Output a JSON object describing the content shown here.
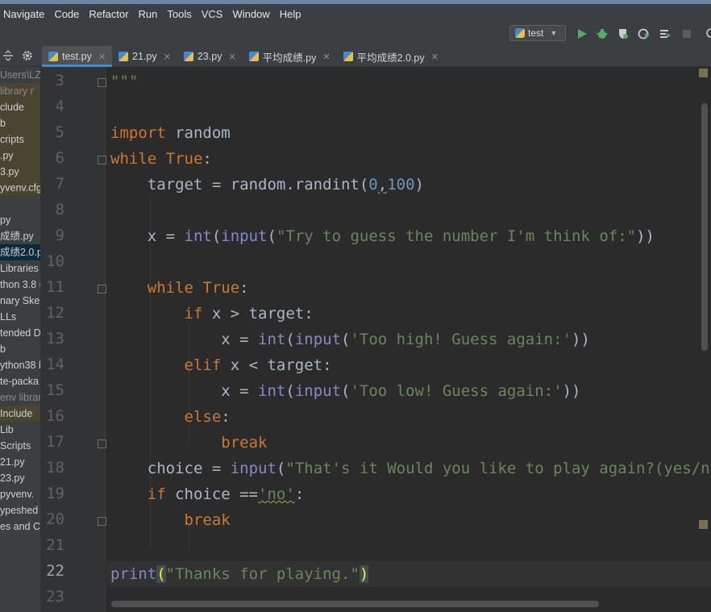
{
  "menu": [
    "Navigate",
    "Code",
    "Refactor",
    "Run",
    "Tools",
    "VCS",
    "Window",
    "Help"
  ],
  "run_config": {
    "label": "test"
  },
  "tabs": [
    {
      "label": "test.py",
      "active": true
    },
    {
      "label": "21.py",
      "active": false
    },
    {
      "label": "23.py",
      "active": false
    },
    {
      "label": "平均成绩.py",
      "active": false
    },
    {
      "label": "平均成绩2.0.py",
      "active": false
    }
  ],
  "sidebar": [
    "Users\\LZ",
    " library r",
    "clude",
    "b",
    "cripts",
    ".py",
    "3.py",
    "yvenv.cfg",
    "",
    "py",
    "成绩.py",
    "成绩2.0.py",
    " Libraries",
    "thon 3.8 (",
    "nary Ske",
    "LLs",
    "tended D",
    "b",
    "ython38  l",
    "te-packa",
    "env  librar",
    " Include",
    " Lib",
    " Scripts",
    "21.py",
    "23.py",
    " pyvenv.",
    "ypeshed",
    "es and Co"
  ],
  "line_numbers": [
    "3",
    "4",
    "5",
    "6",
    "7",
    "8",
    "9",
    "10",
    "11",
    "12",
    "13",
    "14",
    "15",
    "16",
    "17",
    "18",
    "19",
    "20",
    "21",
    "22",
    "23"
  ],
  "current_line": "22",
  "code": {
    "l3": "\"\"\"",
    "l5_kw": "import",
    "l5_rest": " random",
    "l6_kw": "while",
    "l6_true": " True",
    "l6_rest": ":",
    "l7_a": "    target = random.randint(",
    "l7_n1": "0",
    "l7_c": ",",
    "l7_n2": "100",
    "l7_z": ")",
    "l9_a": "    x = ",
    "l9_int": "int",
    "l9_p": "(",
    "l9_input": "input",
    "l9_p2": "(",
    "l9_str": "\"Try to guess the number I'm think of:\"",
    "l9_z": "))",
    "l11_a": "    ",
    "l11_kw": "while",
    "l11_true": " True",
    "l11_z": ":",
    "l12_a": "        ",
    "l12_kw": "if",
    "l12_rest": " x > target:",
    "l13_a": "            x = ",
    "l13_int": "int",
    "l13_p": "(",
    "l13_input": "input",
    "l13_p2": "(",
    "l13_str": "'Too high! Guess again:'",
    "l13_z": "))",
    "l14_a": "        ",
    "l14_kw": "elif",
    "l14_rest": " x < target:",
    "l15_a": "            x = ",
    "l15_int": "int",
    "l15_p": "(",
    "l15_input": "input",
    "l15_p2": "(",
    "l15_str": "'Too low! Guess again:'",
    "l15_z": "))",
    "l16_a": "        ",
    "l16_kw": "else",
    "l16_z": ":",
    "l17_a": "            ",
    "l17_kw": "break",
    "l18_a": "    choice = ",
    "l18_input": "input",
    "l18_p": "(",
    "l18_str": "\"That's it Would you like to play again?(yes/no)\"",
    "l19_a": "    ",
    "l19_kw": "if",
    "l19_rest": " choice ==",
    "l19_str": "'no'",
    "l19_z": ":",
    "l20_a": "        ",
    "l20_kw": "break",
    "l22_print": "print",
    "l22_p": "(",
    "l22_str": "\"Thanks for playing.\"",
    "l22_z": ")"
  },
  "colors": {
    "keyword": "#cc7832",
    "string": "#6a8759",
    "number": "#6897bb",
    "builtin": "#8888c6",
    "text": "#a9b7c6",
    "background": "#2b2b2b"
  },
  "icons": [
    "settings-icon",
    "collapse-icon",
    "python-file-icon",
    "run-icon",
    "debug-icon",
    "coverage-icon",
    "profile-icon",
    "concurrency-icon",
    "stop-icon"
  ]
}
